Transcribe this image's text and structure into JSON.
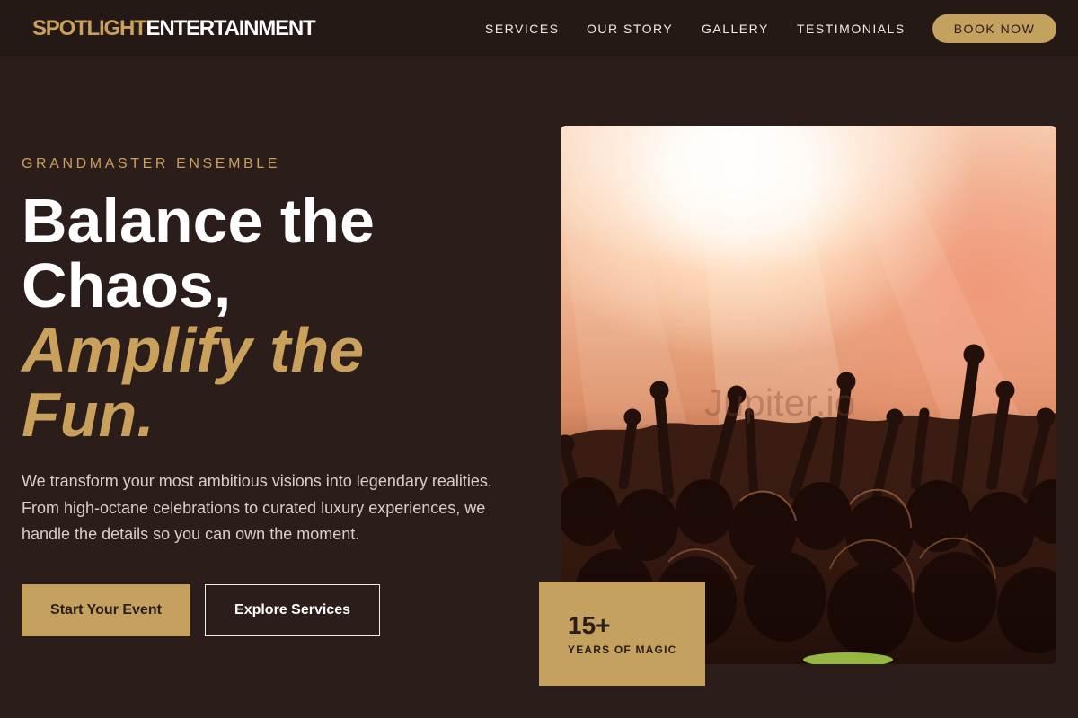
{
  "brand": {
    "part1": "SPOTLIGHT",
    "part2": "ENTERTAINMENT"
  },
  "nav": {
    "links": [
      "SERVICES",
      "OUR STORY",
      "GALLERY",
      "TESTIMONIALS"
    ],
    "cta": "BOOK NOW"
  },
  "hero": {
    "eyebrow": "GRANDMASTER ENSEMBLE",
    "headline": {
      "line1": "Balance the",
      "line2": "Chaos,",
      "accent_line1": "Amplify the",
      "accent_line2": "Fun."
    },
    "description": "We transform your most ambitious visions into legendary realities. From high-octane celebrations to curated luxury experiences, we handle the details so you can own the moment.",
    "primary_button": "Start Your Event",
    "secondary_button": "Explore Services",
    "image_watermark": "Jupiter.io"
  },
  "badge": {
    "number": "15+",
    "label": "YEARS OF MAGIC"
  },
  "colors": {
    "background": "#2a1d1a",
    "accent": "#c4a15e",
    "text": "#ffffff"
  }
}
